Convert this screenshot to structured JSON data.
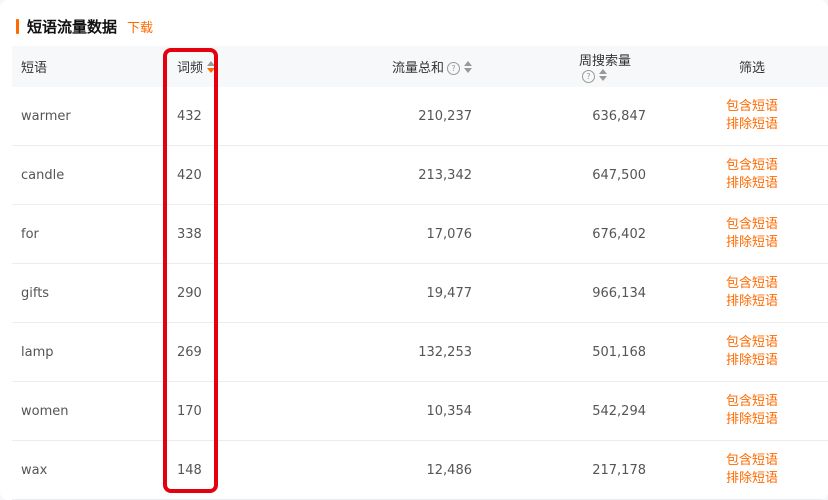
{
  "header": {
    "title": "短语流量数据",
    "download_label": "下载"
  },
  "table": {
    "columns": {
      "phrase": "短语",
      "frequency": "词频",
      "traffic": "流量总和",
      "weekly_search": "周搜索量",
      "filter": "筛选"
    },
    "include_label": "包含短语",
    "exclude_label": "排除短语",
    "rows": [
      {
        "phrase": "warmer",
        "frequency": "432",
        "traffic": "210,237",
        "weekly_search": "636,847"
      },
      {
        "phrase": "candle",
        "frequency": "420",
        "traffic": "213,342",
        "weekly_search": "647,500"
      },
      {
        "phrase": "for",
        "frequency": "338",
        "traffic": "17,076",
        "weekly_search": "676,402"
      },
      {
        "phrase": "gifts",
        "frequency": "290",
        "traffic": "19,477",
        "weekly_search": "966,134"
      },
      {
        "phrase": "lamp",
        "frequency": "269",
        "traffic": "132,253",
        "weekly_search": "501,168"
      },
      {
        "phrase": "women",
        "frequency": "170",
        "traffic": "10,354",
        "weekly_search": "542,294"
      },
      {
        "phrase": "wax",
        "frequency": "148",
        "traffic": "12,486",
        "weekly_search": "217,178"
      }
    ]
  },
  "colors": {
    "accent": "#ff6a00",
    "highlight": "#e4000f"
  },
  "icons": {
    "help": "question-circle-icon",
    "sort": "sort-caret-icon"
  }
}
